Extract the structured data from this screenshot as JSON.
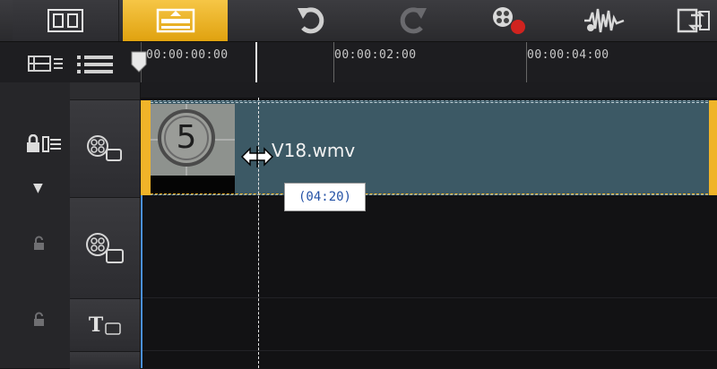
{
  "toolbar": {
    "tabs": [
      {
        "name": "storyboard-view",
        "icon": "film-strip-icon"
      },
      {
        "name": "timeline-view",
        "icon": "timeline-icon",
        "active": true
      }
    ],
    "actions": [
      {
        "name": "undo-button",
        "icon": "undo-icon"
      },
      {
        "name": "redo-button",
        "icon": "redo-icon",
        "disabled": true
      },
      {
        "name": "record-capture-button",
        "icon": "record-icon"
      },
      {
        "name": "sound-mixer-button",
        "icon": "audio-wave-icon"
      },
      {
        "name": "auto-music-button",
        "icon": "transition-icon"
      }
    ]
  },
  "ruler": {
    "timecodes": [
      "00:00:00:00",
      "00:00:02:00",
      "00:00:04:00"
    ]
  },
  "header": {
    "add_remove_label": "+/−"
  },
  "clip": {
    "filename": "V18.wmv",
    "thumbnail_number": "5",
    "tooltip": "(04:20)"
  },
  "tracks": [
    {
      "name": "video-track",
      "icon": "video-track-icon"
    },
    {
      "name": "overlay-track",
      "icon": "overlay-track-icon"
    },
    {
      "name": "title-track",
      "icon": "title-track-icon",
      "label": "T"
    },
    {
      "name": "voice-track",
      "icon": "voice-track-icon"
    }
  ],
  "colors": {
    "accent": "#f0b429",
    "clip_fill": "#3c5965",
    "playhead": "#e8e8e8",
    "tooltip_text": "#2452a6"
  }
}
